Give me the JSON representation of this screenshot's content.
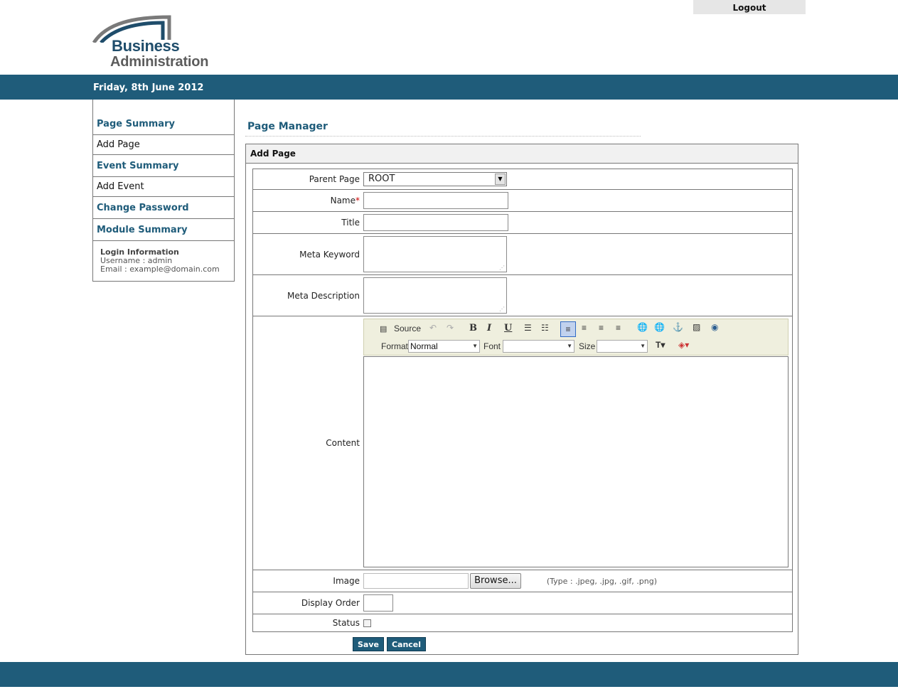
{
  "header": {
    "logout_label": "Logout",
    "logo_line1": "Business",
    "logo_line2": "Administration",
    "date": "Friday, 8th June 2012"
  },
  "sidebar": {
    "items": [
      {
        "label": "Page Summary",
        "kind": "heading"
      },
      {
        "label": "Add Page",
        "kind": "link"
      },
      {
        "label": "Event Summary",
        "kind": "heading"
      },
      {
        "label": "Add Event",
        "kind": "link"
      },
      {
        "label": "Change Password",
        "kind": "heading"
      },
      {
        "label": "Module Summary",
        "kind": "heading"
      }
    ],
    "login": {
      "title": "Login Information",
      "username": "Username : admin",
      "email": "Email : example@domain.com"
    }
  },
  "main": {
    "title": "Page Manager",
    "panel_title": "Add Page",
    "form": {
      "parent_page_label": "Parent Page",
      "parent_page_value": "ROOT",
      "name_label": "Name",
      "name_required": "*",
      "title_label": "Title",
      "meta_keyword_label": "Meta Keyword",
      "meta_description_label": "Meta Description",
      "content_label": "Content",
      "image_label": "Image",
      "browse_label": "Browse...",
      "image_types_note": "(Type : .jpeg, .jpg, .gif, .png)",
      "display_order_label": "Display Order",
      "status_label": "Status"
    },
    "editor": {
      "source_label": "Source",
      "format_label": "Format",
      "format_value": "Normal",
      "font_label": "Font",
      "font_value": "",
      "size_label": "Size",
      "size_value": "",
      "bold_glyph": "B",
      "italic_glyph": "I",
      "underline_glyph": "U"
    },
    "save_label": "Save",
    "cancel_label": "Cancel"
  }
}
